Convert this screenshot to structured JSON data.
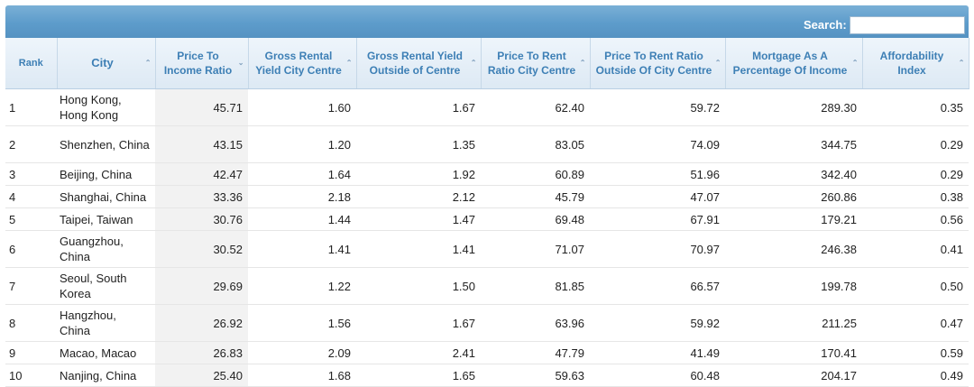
{
  "search": {
    "label": "Search:",
    "value": ""
  },
  "columns": [
    {
      "key": "rank",
      "label": "Rank",
      "sort": ""
    },
    {
      "key": "city",
      "label": "City",
      "sort": "⌃"
    },
    {
      "key": "price_to_income",
      "label": "Price To Income Ratio",
      "sort": "⌄"
    },
    {
      "key": "yield_centre",
      "label": "Gross Rental Yield City Centre",
      "sort": "⌃"
    },
    {
      "key": "yield_outside",
      "label": "Gross Rental Yield Outside of Centre",
      "sort": "⌃"
    },
    {
      "key": "ptr_centre",
      "label": "Price To Rent Ratio City Centre",
      "sort": "⌃"
    },
    {
      "key": "ptr_outside",
      "label": "Price To Rent Ratio Outside Of City Centre",
      "sort": "⌃"
    },
    {
      "key": "mortgage",
      "label": "Mortgage As A Percentage Of Income",
      "sort": "⌃"
    },
    {
      "key": "affordability",
      "label": "Affordability Index",
      "sort": "⌃"
    }
  ],
  "rows": [
    [
      "1",
      "Hong Kong, Hong Kong",
      "45.71",
      "1.60",
      "1.67",
      "62.40",
      "59.72",
      "289.30",
      "0.35"
    ],
    [
      "2",
      "Shenzhen, China",
      "43.15",
      "1.20",
      "1.35",
      "83.05",
      "74.09",
      "344.75",
      "0.29"
    ],
    [
      "3",
      "Beijing, China",
      "42.47",
      "1.64",
      "1.92",
      "60.89",
      "51.96",
      "342.40",
      "0.29"
    ],
    [
      "4",
      "Shanghai, China",
      "33.36",
      "2.18",
      "2.12",
      "45.79",
      "47.07",
      "260.86",
      "0.38"
    ],
    [
      "5",
      "Taipei, Taiwan",
      "30.76",
      "1.44",
      "1.47",
      "69.48",
      "67.91",
      "179.21",
      "0.56"
    ],
    [
      "6",
      "Guangzhou, China",
      "30.52",
      "1.41",
      "1.41",
      "71.07",
      "70.97",
      "246.38",
      "0.41"
    ],
    [
      "7",
      "Seoul, South Korea",
      "29.69",
      "1.22",
      "1.50",
      "81.85",
      "66.57",
      "199.78",
      "0.50"
    ],
    [
      "8",
      "Hangzhou, China",
      "26.92",
      "1.56",
      "1.67",
      "63.96",
      "59.92",
      "211.25",
      "0.47"
    ],
    [
      "9",
      "Macao, Macao",
      "26.83",
      "2.09",
      "2.41",
      "47.79",
      "41.49",
      "170.41",
      "0.59"
    ],
    [
      "10",
      "Nanjing, China",
      "25.40",
      "1.68",
      "1.65",
      "59.63",
      "60.48",
      "204.17",
      "0.49"
    ]
  ]
}
